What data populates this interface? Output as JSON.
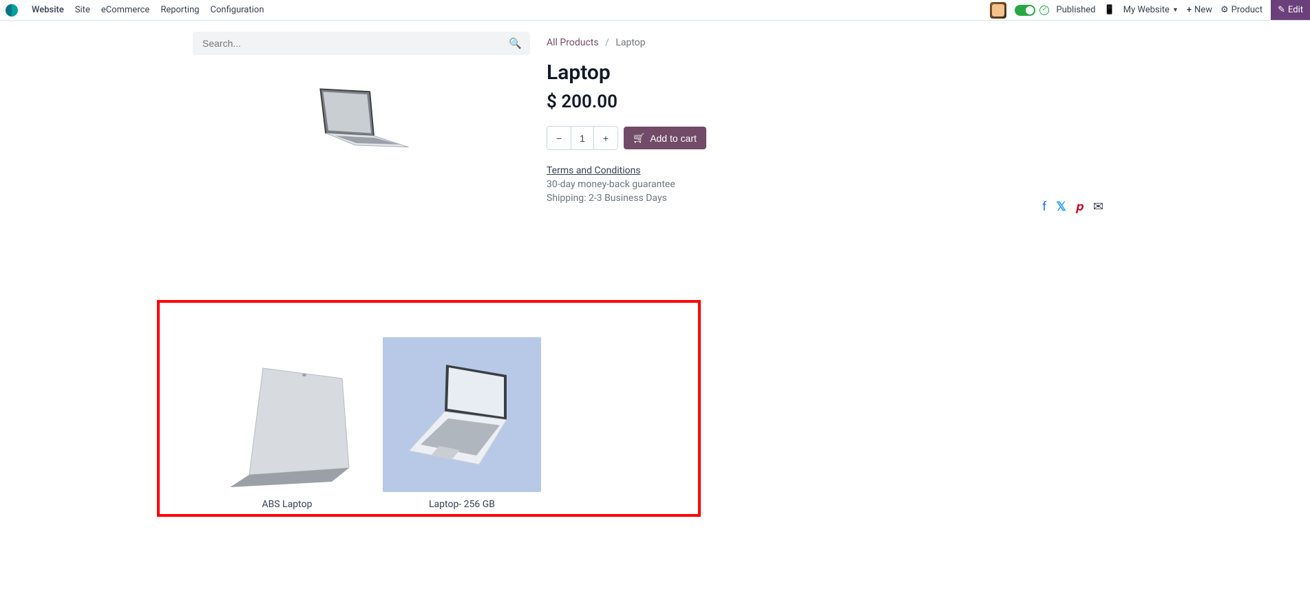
{
  "topbar": {
    "app_name": "Website",
    "nav": [
      "Site",
      "eCommerce",
      "Reporting",
      "Configuration"
    ],
    "published_label": "Published",
    "my_website_label": "My Website",
    "new_label": "New",
    "product_label": "Product",
    "edit_label": "Edit"
  },
  "search": {
    "placeholder": "Search..."
  },
  "breadcrumb": {
    "all_products": "All Products",
    "current": "Laptop"
  },
  "product": {
    "title": "Laptop",
    "currency": "$",
    "price": "200.00",
    "quantity": "1",
    "add_to_cart": "Add to cart",
    "terms_label": "Terms and Conditions",
    "guarantee": "30-day money-back guarantee",
    "shipping": "Shipping: 2-3 Business Days"
  },
  "related": {
    "items": [
      {
        "name": "ABS Laptop"
      },
      {
        "name": "Laptop- 256 GB"
      }
    ]
  }
}
